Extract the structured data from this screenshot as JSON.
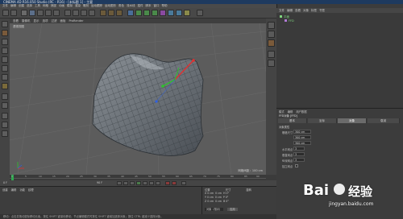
{
  "window": {
    "title": "CINEMA 4D R16.050 Studio (RC - R16) - [未标题 1] - 主要"
  },
  "menubar": {
    "items": [
      "文件",
      "编辑",
      "创建",
      "选择",
      "工具",
      "网格",
      "捕捉",
      "动画",
      "模拟",
      "渲染",
      "雕刻",
      "运动跟踪",
      "运动图形",
      "角色",
      "流水线",
      "插件",
      "脚本",
      "窗口",
      "帮助"
    ]
  },
  "viewport": {
    "menu": [
      "查看",
      "摄像机",
      "显示",
      "选项",
      "过滤",
      "面板",
      "ProRender"
    ],
    "label": "透视视图",
    "grid_info": "网格间距：100 cm"
  },
  "object_manager": {
    "menu": [
      "文件",
      "编辑",
      "查看",
      "对象",
      "标签",
      "书签"
    ],
    "objects": [
      {
        "name": "平面",
        "color": "#7fd47f"
      },
      {
        "name": "FFD",
        "color": "#7fd47f"
      }
    ]
  },
  "attributes": {
    "menu": [
      "模式",
      "编辑",
      "用户数据"
    ],
    "object_label": "FFD对象 [FFD]",
    "tabs": [
      "基本",
      "坐标",
      "对象",
      "衰减"
    ],
    "active_tab": "对象",
    "section": "对象属性",
    "rows": [
      {
        "label": "栅格尺寸",
        "value": "300 cm"
      },
      {
        "label": "",
        "value": "300 cm"
      },
      {
        "label": "",
        "value": "300 cm"
      },
      {
        "label": "水平网点",
        "value": "3"
      },
      {
        "label": "垂直网点",
        "value": "3"
      },
      {
        "label": "纵深网点",
        "value": "3"
      },
      {
        "label": "独立网点",
        "value": ""
      }
    ]
  },
  "timeline": {
    "ticks": [
      "0",
      "5",
      "10",
      "15",
      "20",
      "25",
      "30",
      "35",
      "40",
      "45",
      "50",
      "55",
      "60",
      "65",
      "70",
      "75",
      "80",
      "85",
      "90"
    ],
    "frame": "0 F",
    "end_frame": "90 F"
  },
  "material": {
    "menu": [
      "创建",
      "编辑",
      "功能",
      "纹理"
    ]
  },
  "coordinates": {
    "headers": [
      "位置",
      "尺寸",
      "旋转"
    ],
    "rows": [
      {
        "axis": "X",
        "pos": "0 cm",
        "size": "0 cm",
        "rot": "H 0°"
      },
      {
        "axis": "Y",
        "pos": "0 cm",
        "size": "0 cm",
        "rot": "P 0°"
      },
      {
        "axis": "Z",
        "pos": "0 cm",
        "size": "0 cm",
        "rot": "B 0°"
      }
    ],
    "mode": "对象（相对）",
    "apply": "应用"
  },
  "status": {
    "text": "移动：点击并拖动鼠标移动元素。按住 SHIFT 键量化移动；节点编辑模式时按住 SHIFT 键增加选择对象；按住 CTRL 键减少选择对象。"
  },
  "watermark": {
    "brand": "Bai",
    "brand2": "经验",
    "url": "jingyan.baidu.com"
  },
  "colors": {
    "accent": "#2a64c8",
    "object_green": "#7fd47f",
    "axis_x": "#e03030",
    "axis_y": "#30c030",
    "axis_z": "#3060e0"
  }
}
